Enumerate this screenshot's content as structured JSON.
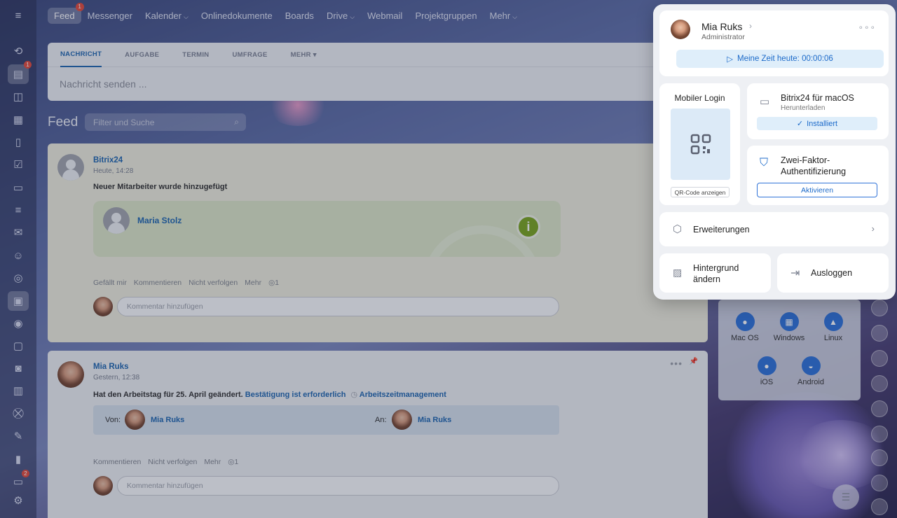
{
  "topnav": {
    "items": [
      "Feed",
      "Messenger",
      "Kalender",
      "Onlinedokumente",
      "Boards",
      "Drive",
      "Webmail",
      "Projektgruppen",
      "Mehr"
    ],
    "feed_badge": "1"
  },
  "sidebar": {
    "messages_badge": "1",
    "bottom_badge": "2"
  },
  "composer": {
    "tabs": [
      "NACHRICHT",
      "AUFGABE",
      "TERMIN",
      "UMFRAGE",
      "MEHR"
    ],
    "placeholder": "Nachricht senden ..."
  },
  "feed": {
    "title": "Feed",
    "filter_placeholder": "Filter und Suche"
  },
  "post1": {
    "author": "Bitrix24",
    "time": "Heute, 14:28",
    "text": "Neuer Mitarbeiter wurde hinzugefügt",
    "new_employee": "Maria Stolz",
    "actions": [
      "Gefällt mir",
      "Kommentieren",
      "Nicht verfolgen",
      "Mehr"
    ],
    "views": "1",
    "comment_placeholder": "Kommentar hinzufügen"
  },
  "post2": {
    "author": "Mia Ruks",
    "time": "Gestern, 12:38",
    "text": "Hat den Arbeitstag für 25. April geändert.",
    "confirm": "Bestätigung ist erforderlich",
    "module": "Arbeitszeitmanagement",
    "von_label": "Von:",
    "von_name": "Mia Ruks",
    "an_label": "An:",
    "an_name": "Mia Ruks",
    "actions": [
      "Kommentieren",
      "Nicht verfolgen",
      "Mehr"
    ],
    "views": "1",
    "comment_placeholder": "Kommentar hinzufügen"
  },
  "downloads": {
    "items": [
      "Mac OS",
      "Windows",
      "Linux",
      "iOS",
      "Android"
    ]
  },
  "popup": {
    "user_name": "Mia Ruks",
    "user_role": "Administrator",
    "time_today": "Meine Zeit heute: 00:00:06",
    "mobile_login": "Mobiler Login",
    "qr_button": "QR-Code anzeigen",
    "app_title": "Bitrix24 für macOS",
    "app_sub": "Herunterladen",
    "installed": "Installiert",
    "twofa_title": "Zwei-Faktor-Authentifizierung",
    "activate": "Aktivieren",
    "extensions": "Erweiterungen",
    "background": "Hintergrund ändern",
    "logout": "Ausloggen"
  }
}
